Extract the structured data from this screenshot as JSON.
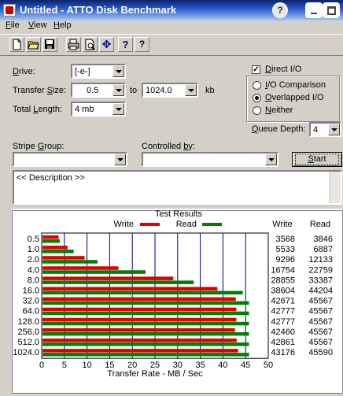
{
  "window": {
    "title": "Untitled - ATTO Disk Benchmark",
    "help_glyph": "?"
  },
  "menu": [
    {
      "label": "File",
      "u": "F",
      "rest": "ile"
    },
    {
      "label": "View",
      "u": "V",
      "rest": "iew"
    },
    {
      "label": "Help",
      "u": "H",
      "rest": "elp"
    }
  ],
  "toolbar": {
    "icons": [
      "new-document-icon",
      "open-folder-icon",
      "save-icon",
      "print-icon",
      "print-preview-icon",
      "move-icon",
      "help-icon",
      "context-help-icon"
    ],
    "glyphs": [
      "",
      "",
      "",
      "",
      "",
      "✥",
      "?",
      "?"
    ]
  },
  "form": {
    "drive_label": {
      "u": "D",
      "rest": "rive:"
    },
    "drive_value": "[-e-]",
    "transfer_size_label": {
      "pre": "Transfer ",
      "u": "S",
      "rest": "ize:"
    },
    "transfer_from": "0.5",
    "to_label": "to",
    "transfer_to": "1024.0",
    "unit": "kb",
    "total_length_label": {
      "pre": "Total ",
      "u": "L",
      "rest": "ength:"
    },
    "total_length_value": "4 mb",
    "direct_io": {
      "pre": "",
      "u": "D",
      "rest": "irect I/O",
      "checked": true
    },
    "io_options": [
      {
        "pre": "",
        "u": "I",
        "rest": "/O Comparison",
        "selected": false
      },
      {
        "pre": "",
        "u": "O",
        "rest": "verlapped I/O",
        "selected": true
      },
      {
        "pre": "",
        "u": "N",
        "rest": "either",
        "selected": false
      }
    ],
    "queue_depth_label": {
      "pre": "",
      "u": "Q",
      "rest": "ueue Depth:"
    },
    "queue_depth_value": "4",
    "stripe_group_label": {
      "pre": "Stripe ",
      "u": "G",
      "rest": "roup:"
    },
    "stripe_group_value": "",
    "controlled_by_label": {
      "pre": "Controlled ",
      "u": "b",
      "rest": "y:"
    },
    "controlled_by_value": "",
    "start_button": {
      "pre": "",
      "u": "S",
      "rest": "tart"
    },
    "description": "<< Description >>"
  },
  "chart_data": {
    "type": "bar",
    "title": "Test Results",
    "orientation": "horizontal",
    "categories": [
      "0.5",
      "1.0",
      "2.0",
      "4.0",
      "8.0",
      "16.0",
      "32.0",
      "64.0",
      "128.0",
      "256.0",
      "512.0",
      "1024.0"
    ],
    "series": [
      {
        "name": "Write",
        "color": "#e00000",
        "values": [
          3568,
          5533,
          9296,
          16754,
          28855,
          38604,
          42671,
          42777,
          42777,
          42460,
          42861,
          43176
        ]
      },
      {
        "name": "Read",
        "color": "#008000",
        "values": [
          3846,
          6887,
          12133,
          22759,
          33387,
          44204,
          45567,
          45567,
          45567,
          45567,
          45567,
          45590
        ]
      }
    ],
    "xlabel": "Transfer Rate - MB / Sec",
    "xlim": [
      0,
      50
    ],
    "xticks": [
      "0",
      "5",
      "10",
      "15",
      "20",
      "25",
      "30",
      "35",
      "40",
      "45",
      "50"
    ],
    "values_scale": 1000,
    "columns": [
      "Write",
      "Read"
    ],
    "grid": true
  }
}
